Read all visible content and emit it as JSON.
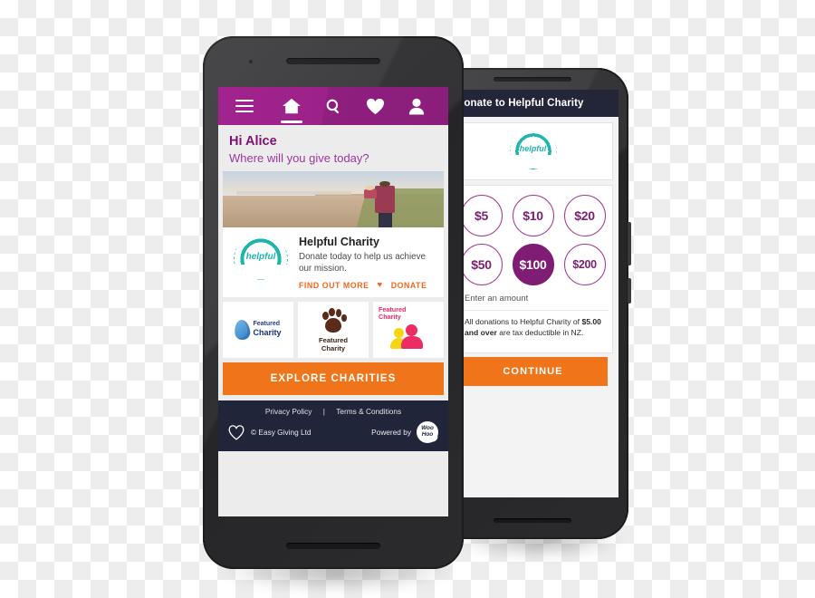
{
  "back_phone": {
    "header_title": "Donate to Helpful Charity",
    "badge": {
      "word": "helpful",
      "ribbon": "CHARITY"
    },
    "amounts": [
      {
        "label": "$5",
        "selected": false
      },
      {
        "label": "$10",
        "selected": false
      },
      {
        "label": "$20",
        "selected": false
      },
      {
        "label": "$50",
        "selected": false
      },
      {
        "label": "$100",
        "selected": true
      },
      {
        "label": "$200",
        "selected": false
      }
    ],
    "other_amount_label": "Enter an amount",
    "tax_note_prefix": "All donations to Helpful Charity of ",
    "tax_note_amount": "$5.00",
    "tax_note_mid": " and over",
    "tax_note_suffix": " are tax deductible in NZ.",
    "continue_label": "CONTINUE"
  },
  "front_phone": {
    "nav": {
      "menu_icon": "hamburger-menu-icon",
      "items": [
        {
          "icon": "home-icon",
          "active": true
        },
        {
          "icon": "search-icon",
          "active": false
        },
        {
          "icon": "heart-icon",
          "active": false
        },
        {
          "icon": "person-icon",
          "active": false
        }
      ]
    },
    "greeting": {
      "hello": "Hi Alice",
      "question": "Where will you give today?"
    },
    "hero_alt": "father holding child on a beach at dusk",
    "charity_card": {
      "badge": {
        "word": "helpful",
        "ribbon": "CHARITY"
      },
      "title": "Helpful Charity",
      "description": "Donate today to help us achieve our mission.",
      "link_find_out_more": "FIND OUT MORE",
      "link_donate": "DONATE",
      "heart_glyph": "♥"
    },
    "tiles": [
      {
        "name": "water-drop-charity",
        "line1": "Featured",
        "line2": "Charity"
      },
      {
        "name": "animal-paw-charity",
        "line1": "Featured",
        "line2": "Charity"
      },
      {
        "name": "people-charity",
        "line1": "Featured",
        "line2": "Charity"
      }
    ],
    "explore_button": "EXPLORE CHARITIES",
    "footer": {
      "privacy": "Privacy Policy",
      "divider": "|",
      "terms": "Terms & Conditions",
      "copyright": "© Easy Giving Ltd",
      "powered_by": "Powered by",
      "brand_line1": "Woo",
      "brand_line2": "Hoo"
    }
  },
  "colors": {
    "purple_header": "#9c2289",
    "purple_text": "#7d1273",
    "purple_sub": "#9b37a0",
    "orange": "#f07419",
    "orange_link": "#f2671f",
    "teal_badge": "#1fb5ad",
    "footer_navy": "#212539",
    "back_header_navy": "#232639",
    "amount_selected": "#7e1d73"
  }
}
